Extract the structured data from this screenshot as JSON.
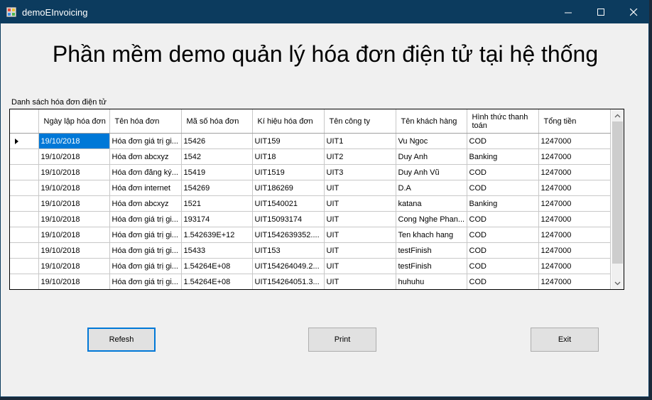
{
  "window": {
    "title": "demoEInvoicing"
  },
  "heading": "Phần mềm demo quản lý hóa đơn điện tử tại hệ thống",
  "grid": {
    "label": "Danh sách hóa đơn điện tử",
    "columns": [
      "Ngày lập hóa đơn",
      "Tên hóa đơn",
      "Mã số hóa đơn",
      "Kí hiệu hóa đơn",
      "Tên công ty",
      "Tên khách hàng",
      "Hình thức thanh toán",
      "Tổng tiền"
    ],
    "rows": [
      [
        "19/10/2018",
        "Hóa đơn giá trị gi...",
        "15426",
        "UIT159",
        "UIT1",
        "Vu Ngoc",
        "COD",
        "1247000"
      ],
      [
        "19/10/2018",
        "Hóa đơn abcxyz",
        "1542",
        "UIT18",
        "UIT2",
        "Duy Anh",
        "Banking",
        "1247000"
      ],
      [
        "19/10/2018",
        "Hóa đơn đăng ký...",
        "15419",
        "UIT1519",
        "UIT3",
        "Duy Anh Vũ",
        "COD",
        "1247000"
      ],
      [
        "19/10/2018",
        "Hóa đơn internet",
        "154269",
        "UIT186269",
        "UIT",
        "D.A",
        "COD",
        "1247000"
      ],
      [
        "19/10/2018",
        "Hóa đơn abcxyz",
        "1521",
        "UIT1540021",
        "UIT",
        "katana",
        "Banking",
        "1247000"
      ],
      [
        "19/10/2018",
        "Hóa đơn giá trị gi...",
        "193174",
        "UIT15093174",
        "UIT",
        "Cong Nghe Phan...",
        "COD",
        "1247000"
      ],
      [
        "19/10/2018",
        "Hóa đơn giá trị gi...",
        "1.542639E+12",
        "UIT1542639352....",
        "UIT",
        "Ten khach hang",
        "COD",
        "1247000"
      ],
      [
        "19/10/2018",
        "Hóa đơn giá trị gi...",
        "15433",
        "UIT153",
        "UIT",
        "testFinish",
        "COD",
        "1247000"
      ],
      [
        "19/10/2018",
        "Hóa đơn giá trị gi...",
        "1.54264E+08",
        "UIT154264049.2...",
        "UIT",
        "testFinish",
        "COD",
        "1247000"
      ],
      [
        "19/10/2018",
        "Hóa đơn giá trị gi...",
        "1.54264E+08",
        "UIT154264051.3...",
        "UIT",
        "huhuhu",
        "COD",
        "1247000"
      ]
    ]
  },
  "buttons": {
    "refresh": "Refesh",
    "print": "Print",
    "exit": "Exit"
  },
  "icons": {
    "app": "app-icon",
    "minimize": "minimize-icon",
    "maximize": "maximize-icon",
    "close": "close-icon",
    "row_indicator": "triangle-right-icon",
    "scroll_up": "chevron-up-icon",
    "scroll_down": "chevron-down-icon"
  },
  "colors": {
    "titlebar": "#0c3b5e",
    "selection": "#0078d7",
    "window_bg": "#f0f0f0"
  }
}
